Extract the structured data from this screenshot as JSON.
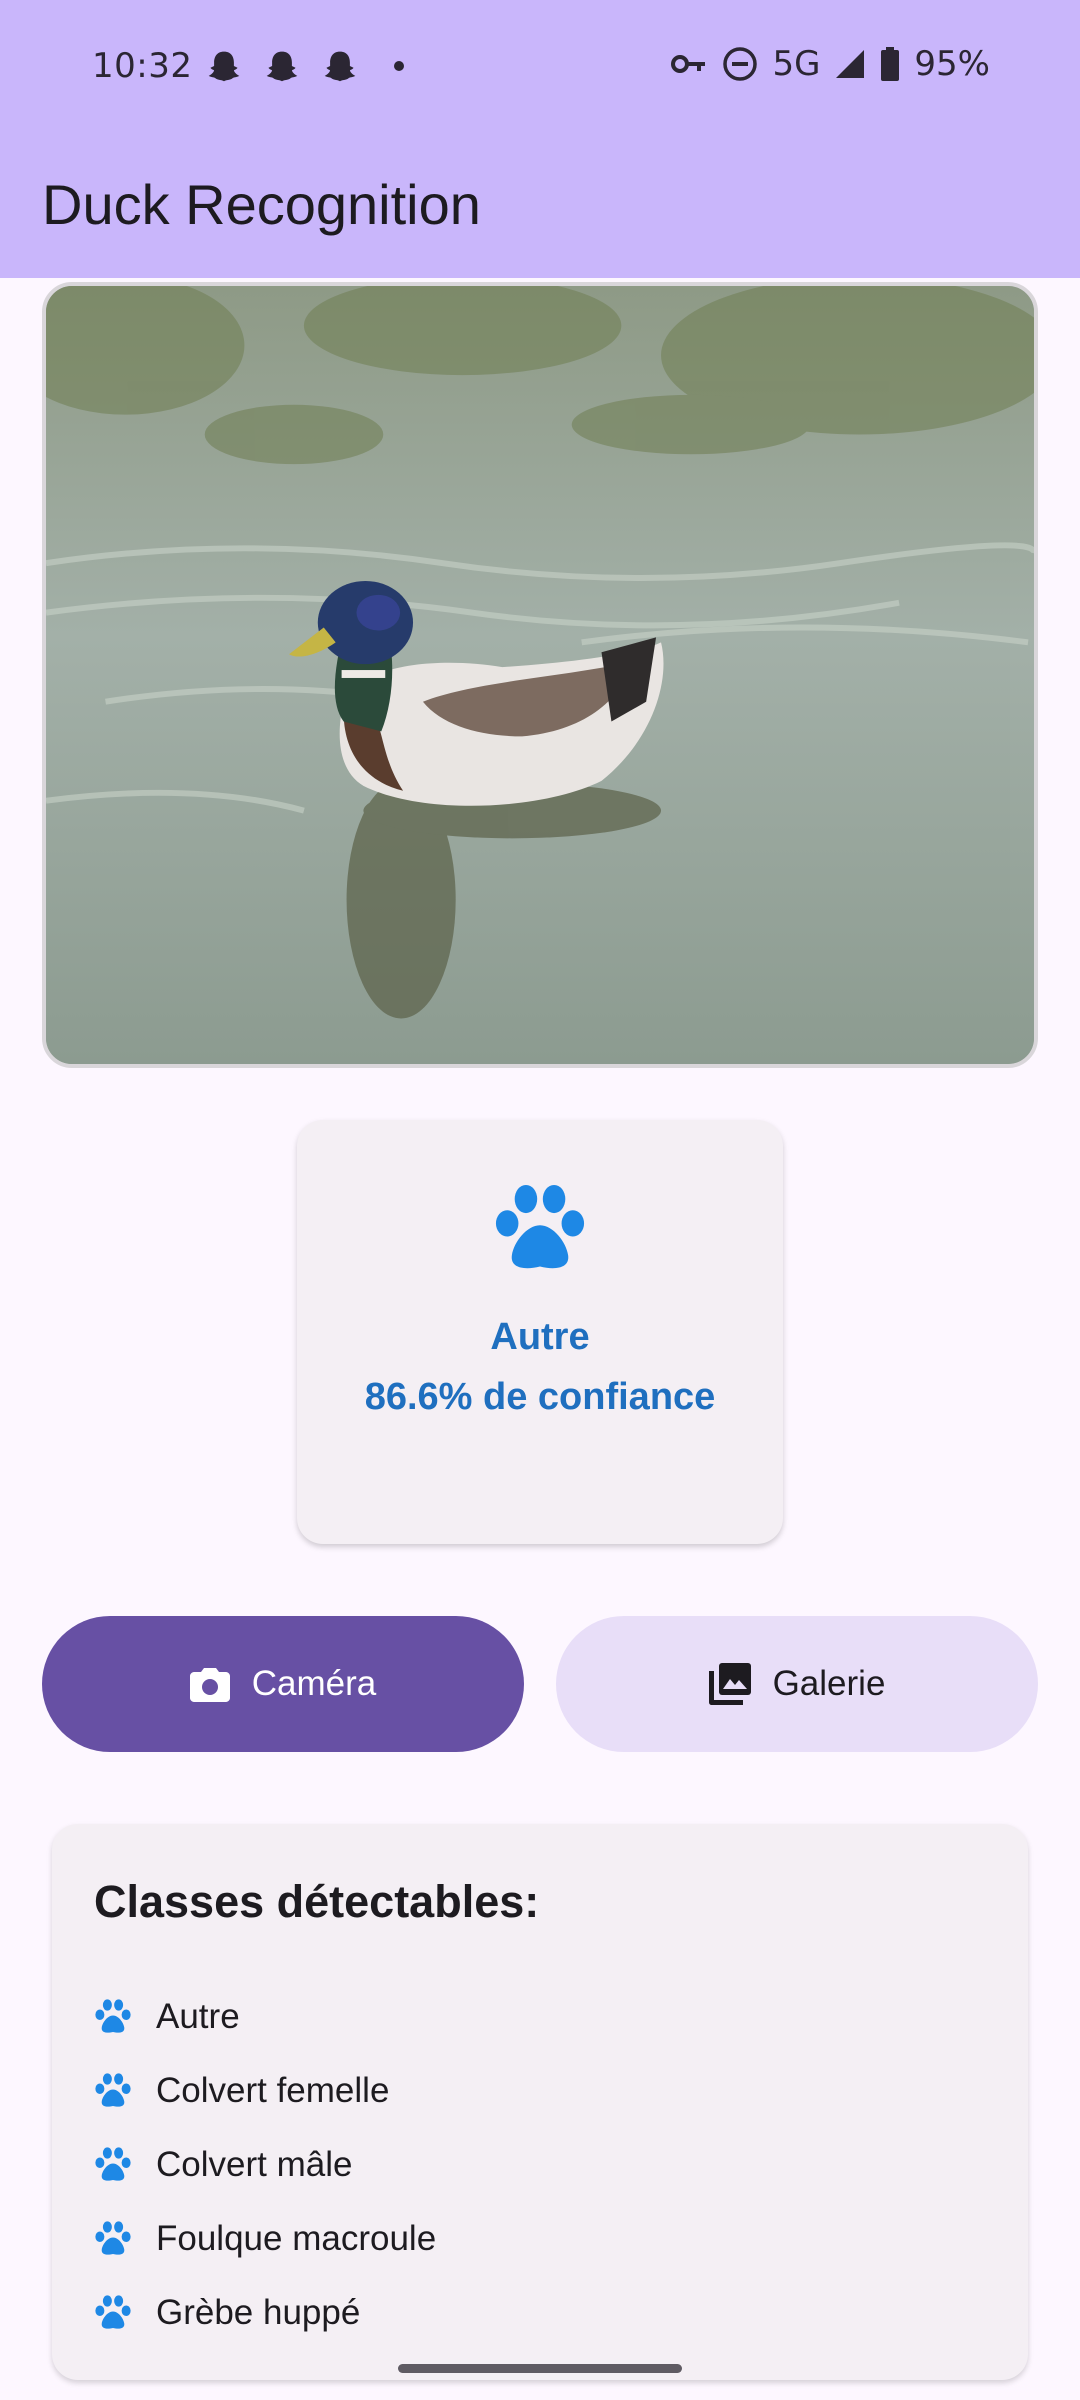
{
  "status_bar": {
    "time": "10:32",
    "network": "5G",
    "battery": "95%",
    "icons": [
      "snapchat-icon",
      "snapchat-icon",
      "snapchat-icon",
      "notification-dot-icon",
      "vpn-key-icon",
      "do-not-disturb-icon",
      "signal-icon",
      "battery-icon"
    ]
  },
  "app_bar": {
    "title": "Duck Recognition"
  },
  "result": {
    "icon": "paw-icon",
    "label": "Autre",
    "confidence_text": "86.6% de confiance"
  },
  "buttons": {
    "camera_label": "Caméra",
    "camera_icon": "camera-icon",
    "gallery_label": "Galerie",
    "gallery_icon": "gallery-icon"
  },
  "classes": {
    "title": "Classes détectables:",
    "items": [
      "Autre",
      "Colvert femelle",
      "Colvert mâle",
      "Foulque macroule",
      "Grèbe huppé"
    ]
  },
  "colors": {
    "app_bar": "#c9b6fb",
    "background": "#fdf7ff",
    "primary": "#6750a4",
    "secondary_container": "#e8def8",
    "accent_blue": "#1e88e5",
    "result_text": "#1f6fbf"
  }
}
